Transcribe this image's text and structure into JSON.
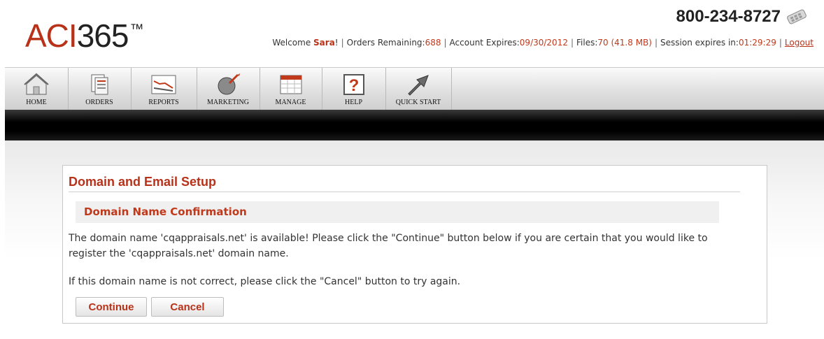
{
  "brand": {
    "logo_part1": "ACI",
    "logo_part2": "365",
    "trademark": "™"
  },
  "header": {
    "phone": "800-234-8727",
    "welcome_prefix": "Welcome ",
    "user_name": "Sara",
    "user_suffix": "!",
    "separator": "|",
    "orders_label": "Orders Remaining:",
    "orders_value": "688",
    "expires_label": "Account Expires:",
    "expires_value": "09/30/2012",
    "files_label": "Files:",
    "files_value": "70 (41.8 MB)",
    "session_label": "Session expires in:",
    "session_value": "01:29:29",
    "logout_label": "Logout"
  },
  "nav": [
    {
      "label": "HOME",
      "icon": "home-icon"
    },
    {
      "label": "ORDERS",
      "icon": "orders-icon"
    },
    {
      "label": "REPORTS",
      "icon": "reports-icon"
    },
    {
      "label": "MARKETING",
      "icon": "marketing-icon"
    },
    {
      "label": "MANAGE",
      "icon": "manage-icon"
    },
    {
      "label": "HELP",
      "icon": "help-icon"
    },
    {
      "label": "QUICK START",
      "icon": "quick-start-icon"
    }
  ],
  "panel": {
    "title": "Domain and Email Setup",
    "subheader": "Domain Name Confirmation",
    "paragraph1": "The domain name 'cqappraisals.net' is available! Please click the \"Continue\" button below if you are certain that you would like to register the 'cqappraisals.net' domain name.",
    "paragraph2": "If this domain name is not correct, please click the \"Cancel\" button to try again.",
    "continue_label": "Continue",
    "cancel_label": "Cancel"
  },
  "colors": {
    "accent": "#b8321a",
    "value": "#c0391b",
    "navbar": "#dedede",
    "blackbar": "#000000"
  }
}
